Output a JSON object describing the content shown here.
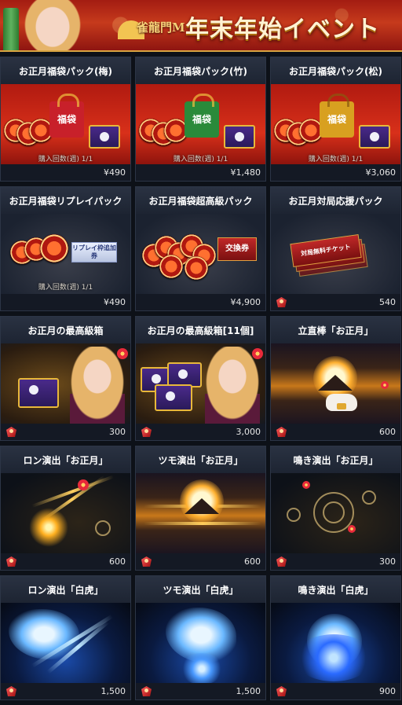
{
  "banner": {
    "logo_sub": "雀龍門M",
    "title": "年末年始イベント"
  },
  "currency": {
    "cash_symbol": "¥",
    "gem_icon": "red-gem-icon"
  },
  "items": [
    {
      "title": "お正月福袋パック(梅)",
      "price": "¥490",
      "currency": "cash",
      "limit": "購入回数(週) 1/1",
      "bag_label": "福袋",
      "bag_color": "#c8202a"
    },
    {
      "title": "お正月福袋パック(竹)",
      "price": "¥1,480",
      "currency": "cash",
      "limit": "購入回数(週) 1/1",
      "bag_label": "福袋",
      "bag_color": "#2a8a3a"
    },
    {
      "title": "お正月福袋パック(松)",
      "price": "¥3,060",
      "currency": "cash",
      "limit": "購入回数(週) 1/1",
      "bag_label": "福袋",
      "bag_color": "#d8a020"
    },
    {
      "title": "お正月福袋リプレイパック",
      "price": "¥490",
      "currency": "cash",
      "limit": "購入回数(週) 1/1",
      "ticket_label": "リプレイ枠追加券"
    },
    {
      "title": "お正月福袋超高級パック",
      "price": "¥4,900",
      "currency": "cash",
      "ticket_label": "交換券"
    },
    {
      "title": "お正月対局応援パック",
      "price": "540",
      "currency": "gem",
      "ticket_label": "対局無料チケット"
    },
    {
      "title": "お正月の最高級箱",
      "price": "300",
      "currency": "gem"
    },
    {
      "title": "お正月の最高級箱[11個]",
      "price": "3,000",
      "currency": "gem"
    },
    {
      "title": "立直棒「お正月」",
      "price": "600",
      "currency": "gem"
    },
    {
      "title": "ロン演出「お正月」",
      "price": "600",
      "currency": "gem"
    },
    {
      "title": "ツモ演出「お正月」",
      "price": "600",
      "currency": "gem"
    },
    {
      "title": "鳴き演出「お正月」",
      "price": "300",
      "currency": "gem"
    },
    {
      "title": "ロン演出「白虎」",
      "price": "1,500",
      "currency": "gem"
    },
    {
      "title": "ツモ演出「白虎」",
      "price": "1,500",
      "currency": "gem"
    },
    {
      "title": "鳴き演出「白虎」",
      "price": "900",
      "currency": "gem"
    }
  ]
}
